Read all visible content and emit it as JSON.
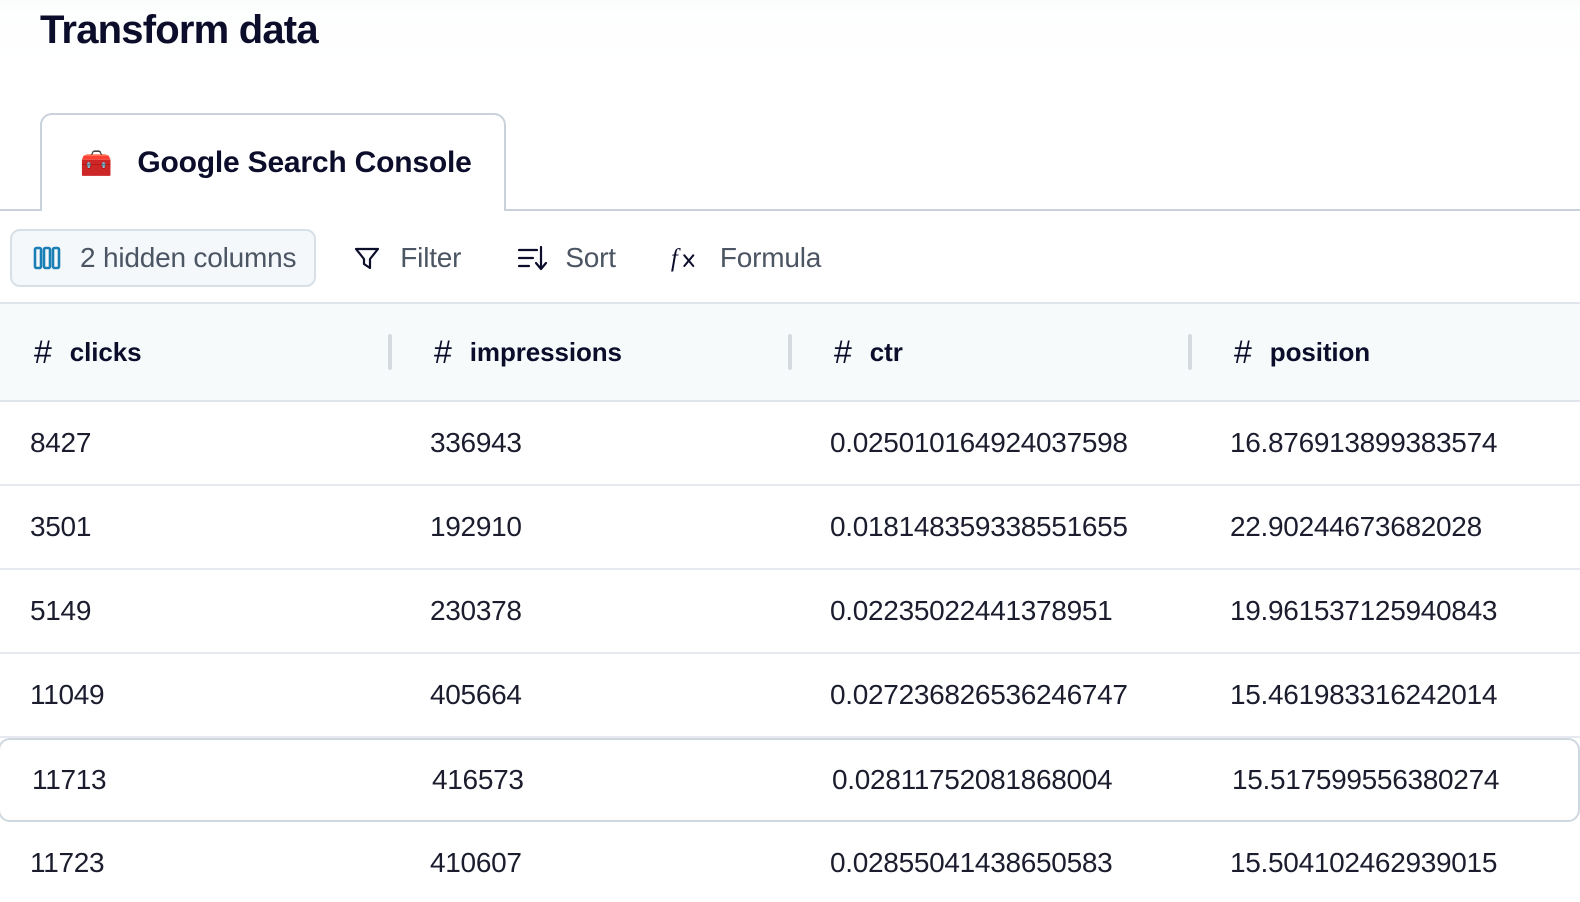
{
  "page": {
    "title": "Transform data"
  },
  "tabs": [
    {
      "label": "Google Search Console",
      "icon": "toolbox-icon",
      "glyph": "🧰",
      "active": true
    }
  ],
  "toolbar": {
    "hidden_columns_label": "2 hidden columns",
    "filter_label": "Filter",
    "sort_label": "Sort",
    "formula_label": "Formula"
  },
  "table": {
    "columns": [
      {
        "name": "clicks",
        "type_symbol": "#"
      },
      {
        "name": "impressions",
        "type_symbol": "#"
      },
      {
        "name": "ctr",
        "type_symbol": "#"
      },
      {
        "name": "position",
        "type_symbol": "#"
      }
    ],
    "rows": [
      {
        "clicks": "8427",
        "impressions": "336943",
        "ctr": "0.025010164924037598",
        "position": "16.876913899383574",
        "active": false
      },
      {
        "clicks": "3501",
        "impressions": "192910",
        "ctr": "0.018148359338551655",
        "position": "22.90244673682028",
        "active": false
      },
      {
        "clicks": "5149",
        "impressions": "230378",
        "ctr": "0.02235022441378951",
        "position": "19.961537125940843",
        "active": false
      },
      {
        "clicks": "11049",
        "impressions": "405664",
        "ctr": "0.027236826536246747",
        "position": "15.461983316242014",
        "active": false
      },
      {
        "clicks": "11713",
        "impressions": "416573",
        "ctr": "0.02811752081868004",
        "position": "15.517599556380274",
        "active": true
      },
      {
        "clicks": "11723",
        "impressions": "410607",
        "ctr": "0.02855041438650583",
        "position": "15.504102462939015",
        "active": false
      }
    ]
  },
  "colors": {
    "accent": "#1a7fb5",
    "title": "#0b0d2b",
    "header_bg": "#f6fafb",
    "border": "#dfe5ea",
    "pill_bg": "#f4f8fa",
    "text_muted": "#4b5563"
  }
}
